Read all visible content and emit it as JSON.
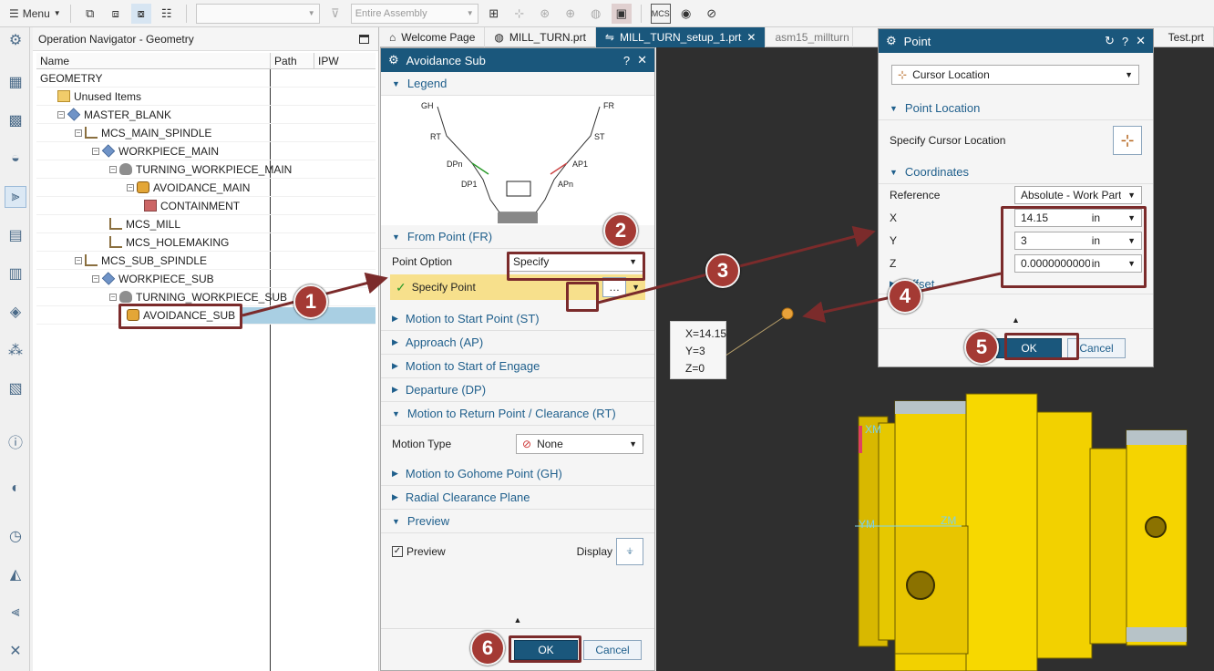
{
  "toolbar": {
    "menu_label": "Menu",
    "assembly_placeholder": "Entire Assembly",
    "filter_value": ""
  },
  "navigator": {
    "title": "Operation Navigator - Geometry",
    "columns": [
      "Name",
      "Path",
      "IPW"
    ],
    "tree": [
      {
        "label": "GEOMETRY",
        "indent": 0,
        "icon": "none",
        "toggle": ""
      },
      {
        "label": "Unused Items",
        "indent": 1,
        "icon": "folder",
        "toggle": ""
      },
      {
        "label": "MASTER_BLANK",
        "indent": 1,
        "icon": "cube",
        "toggle": "-"
      },
      {
        "label": "MCS_MAIN_SPINDLE",
        "indent": 2,
        "icon": "mcs",
        "toggle": "-"
      },
      {
        "label": "WORKPIECE_MAIN",
        "indent": 3,
        "icon": "cube",
        "toggle": "-"
      },
      {
        "label": "TURNING_WORKPIECE_MAIN",
        "indent": 4,
        "icon": "work",
        "toggle": "-"
      },
      {
        "label": "AVOIDANCE_MAIN",
        "indent": 5,
        "icon": "op",
        "toggle": "-"
      },
      {
        "label": "CONTAINMENT",
        "indent": 6,
        "icon": "geo",
        "toggle": ""
      },
      {
        "label": "MCS_MILL",
        "indent": 4,
        "icon": "mcs",
        "toggle": ""
      },
      {
        "label": "MCS_HOLEMAKING",
        "indent": 4,
        "icon": "mcs",
        "toggle": ""
      },
      {
        "label": "MCS_SUB_SPINDLE",
        "indent": 2,
        "icon": "mcs",
        "toggle": "-"
      },
      {
        "label": "WORKPIECE_SUB",
        "indent": 3,
        "icon": "cube",
        "toggle": "-"
      },
      {
        "label": "TURNING_WORKPIECE_SUB",
        "indent": 4,
        "icon": "work",
        "toggle": "-"
      },
      {
        "label": "AVOIDANCE_SUB",
        "indent": 5,
        "icon": "op",
        "toggle": ""
      }
    ]
  },
  "tabs": [
    {
      "label": "Welcome Page"
    },
    {
      "label": "MILL_TURN.prt"
    },
    {
      "label": "MILL_TURN_setup_1.prt"
    },
    {
      "label": "asm15_millturn"
    },
    {
      "label": "Test.prt"
    }
  ],
  "avoidance": {
    "title": "Avoidance Sub",
    "legend_label": "Legend",
    "legend": {
      "gh": "GH",
      "rt": "RT",
      "dpn": "DPn",
      "dp1": "DP1",
      "fr": "FR",
      "st": "ST",
      "ap1": "AP1",
      "apn": "APn"
    },
    "from_point_label": "From Point (FR)",
    "point_option_label": "Point Option",
    "point_option_value": "Specify",
    "specify_point_label": "Specify Point",
    "sections": [
      "Motion to Start Point (ST)",
      "Approach (AP)",
      "Motion to Start of Engage",
      "Departure (DP)"
    ],
    "return_label": "Motion to Return Point / Clearance (RT)",
    "motion_type_label": "Motion Type",
    "motion_type_value": "None",
    "gohome_label": "Motion to Gohome Point (GH)",
    "radial_label": "Radial Clearance Plane",
    "preview_label": "Preview",
    "preview_check_label": "Preview",
    "display_label": "Display",
    "ok": "OK",
    "cancel": "Cancel"
  },
  "point_dialog": {
    "title": "Point",
    "type_value": "Cursor Location",
    "point_location_label": "Point Location",
    "specify_cursor_label": "Specify Cursor Location",
    "coordinates_label": "Coordinates",
    "reference_label": "Reference",
    "reference_value": "Absolute - Work Part",
    "x_label": "X",
    "x_value": "14.15",
    "x_unit": "in",
    "y_label": "Y",
    "y_value": "3",
    "y_unit": "in",
    "z_label": "Z",
    "z_value": "0.0000000000",
    "z_unit": "in",
    "offset_label": "Offset",
    "ok": "OK",
    "cancel": "Cancel"
  },
  "coord_tooltip": {
    "x": "X=14.15",
    "y": "Y=3",
    "z": "Z=0"
  },
  "viewport_labels": {
    "xm": "XM",
    "ym": "YM",
    "zm": "ZM"
  },
  "steps": [
    "1",
    "2",
    "3",
    "4",
    "5",
    "6"
  ],
  "colors": {
    "accent": "#1a577c",
    "callout": "#7b2b2b",
    "badge": "#a43a34",
    "part": "#f5d410"
  }
}
